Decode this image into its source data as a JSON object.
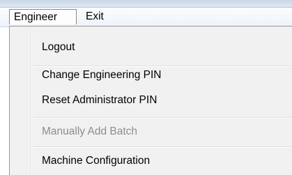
{
  "menubar": {
    "items": [
      {
        "label": "Engineer"
      },
      {
        "label": "Exit"
      }
    ]
  },
  "dropdown": {
    "items": [
      {
        "label": "Logout",
        "enabled": true
      },
      {
        "label": "Change Engineering PIN",
        "enabled": true
      },
      {
        "label": "Reset Administrator PIN",
        "enabled": true
      },
      {
        "label": "Manually Add Batch",
        "enabled": false
      },
      {
        "label": "Machine Configuration",
        "enabled": true
      }
    ]
  },
  "colors": {
    "menu_background": "#f1f1f1",
    "disabled_text": "#8d8d8d",
    "separator": "#e0e0e0"
  }
}
